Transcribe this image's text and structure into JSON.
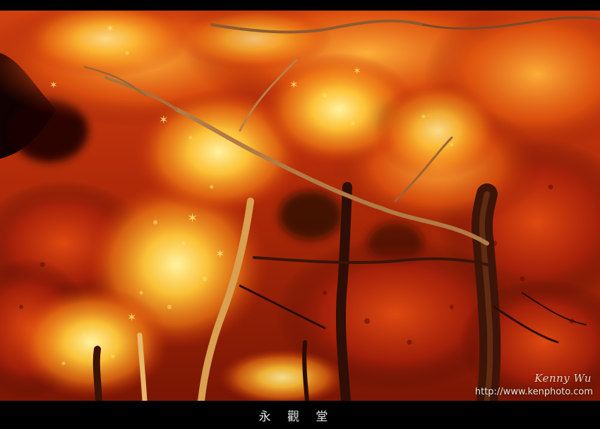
{
  "photo": {
    "subject": "autumn-maple-foliage-night",
    "colors": {
      "background": "#000000",
      "leaf_bright": "#ffd64a",
      "leaf_orange": "#f07a14",
      "leaf_red": "#c42a08",
      "leaf_deep": "#6e1004",
      "trunk": "#4a1c0c"
    }
  },
  "watermark": {
    "signature": "Kenny Wu",
    "url": "http://www.kenphoto.com"
  },
  "caption": {
    "title": "永 觀 堂"
  }
}
